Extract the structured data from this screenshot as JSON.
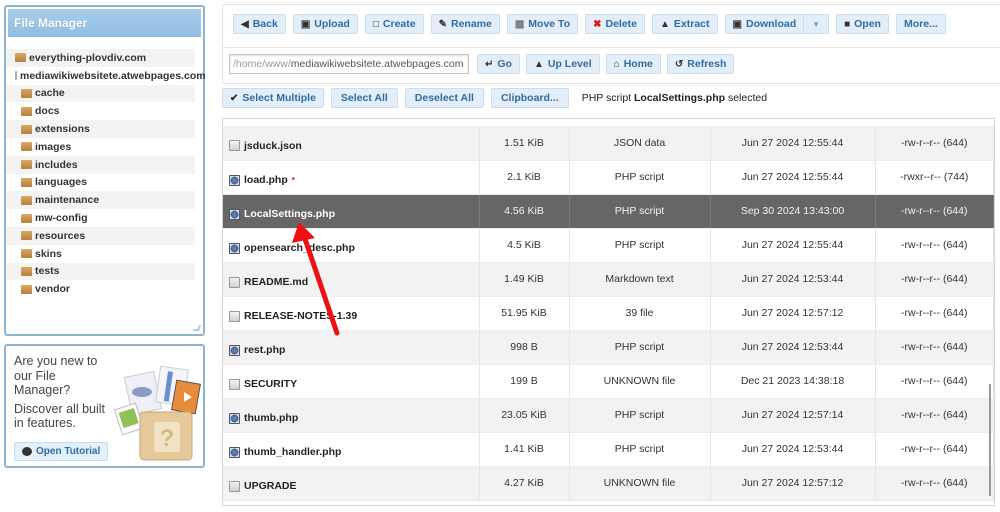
{
  "sidebar": {
    "title": "File Manager",
    "tree": [
      {
        "label": "everything-plovdiv.com",
        "level": 0,
        "open": false
      },
      {
        "label": "mediawikiwebsitete.atwebpages.com",
        "level": 0,
        "open": true
      },
      {
        "label": "cache",
        "level": 1
      },
      {
        "label": "docs",
        "level": 1
      },
      {
        "label": "extensions",
        "level": 1
      },
      {
        "label": "images",
        "level": 1
      },
      {
        "label": "includes",
        "level": 1
      },
      {
        "label": "languages",
        "level": 1
      },
      {
        "label": "maintenance",
        "level": 1
      },
      {
        "label": "mw-config",
        "level": 1
      },
      {
        "label": "resources",
        "level": 1
      },
      {
        "label": "skins",
        "level": 1
      },
      {
        "label": "tests",
        "level": 1
      },
      {
        "label": "vendor",
        "level": 1
      }
    ]
  },
  "tutorial": {
    "question": "Are you new to our File Manager?",
    "description": "Discover all built in features.",
    "button_label": "Open Tutorial"
  },
  "toolbar": {
    "back": "Back",
    "upload": "Upload",
    "create": "Create",
    "rename": "Rename",
    "move_to": "Move To",
    "delete": "Delete",
    "extract": "Extract",
    "download": "Download",
    "open": "Open",
    "more": "More...",
    "go": "Go",
    "up_level": "Up Level",
    "home": "Home",
    "refresh": "Refresh"
  },
  "path": {
    "prefix": "/home/www/",
    "value": "mediawikiwebsitete.atwebpages.com"
  },
  "selection_bar": {
    "select_multiple": "Select Multiple",
    "select_all": "Select All",
    "deselect_all": "Deselect All",
    "clipboard": "Clipboard...",
    "status_prefix": "PHP script",
    "status_file": "LocalSettings.php",
    "status_suffix": "selected"
  },
  "files": [
    {
      "name": "jsduck.json",
      "icon": "file",
      "size": "1.51 KiB",
      "type": "JSON data",
      "modified": "Jun 27 2024 12:55:44",
      "perms": "-rw-r--r-- (644)",
      "changed": false
    },
    {
      "name": "load.php",
      "icon": "php",
      "size": "2.1 KiB",
      "type": "PHP script",
      "modified": "Jun 27 2024 12:55:44",
      "perms": "-rwxr--r-- (744)",
      "changed": true
    },
    {
      "name": "LocalSettings.php",
      "icon": "php",
      "size": "4.56 KiB",
      "type": "PHP script",
      "modified": "Sep 30 2024 13:43:00",
      "perms": "-rw-r--r-- (644)",
      "changed": false,
      "selected": true
    },
    {
      "name": "opensearch_desc.php",
      "icon": "php",
      "size": "4.5 KiB",
      "type": "PHP script",
      "modified": "Jun 27 2024 12:55:44",
      "perms": "-rw-r--r-- (644)",
      "changed": false
    },
    {
      "name": "README.md",
      "icon": "file",
      "size": "1.49 KiB",
      "type": "Markdown text",
      "modified": "Jun 27 2024 12:53:44",
      "perms": "-rw-r--r-- (644)",
      "changed": false
    },
    {
      "name": "RELEASE-NOTES-1.39",
      "icon": "file",
      "size": "51.95 KiB",
      "type": "39 file",
      "modified": "Jun 27 2024 12:57:12",
      "perms": "-rw-r--r-- (644)",
      "changed": false
    },
    {
      "name": "rest.php",
      "icon": "php",
      "size": "998 B",
      "type": "PHP script",
      "modified": "Jun 27 2024 12:53:44",
      "perms": "-rw-r--r-- (644)",
      "changed": false
    },
    {
      "name": "SECURITY",
      "icon": "file",
      "size": "199 B",
      "type": "UNKNOWN file",
      "modified": "Dec 21 2023 14:38:18",
      "perms": "-rw-r--r-- (644)",
      "changed": false
    },
    {
      "name": "thumb.php",
      "icon": "php",
      "size": "23.05 KiB",
      "type": "PHP script",
      "modified": "Jun 27 2024 12:57:14",
      "perms": "-rw-r--r-- (644)",
      "changed": false
    },
    {
      "name": "thumb_handler.php",
      "icon": "php",
      "size": "1.41 KiB",
      "type": "PHP script",
      "modified": "Jun 27 2024 12:53:44",
      "perms": "-rw-r--r-- (644)",
      "changed": false
    },
    {
      "name": "UPGRADE",
      "icon": "file",
      "size": "4.27 KiB",
      "type": "UNKNOWN file",
      "modified": "Jun 27 2024 12:57:12",
      "perms": "-rw-r--r-- (644)",
      "changed": false
    }
  ],
  "colors": {
    "accent": "#2e6da4",
    "selected_row": "#666666",
    "annotation_arrow": "#ee1111"
  }
}
